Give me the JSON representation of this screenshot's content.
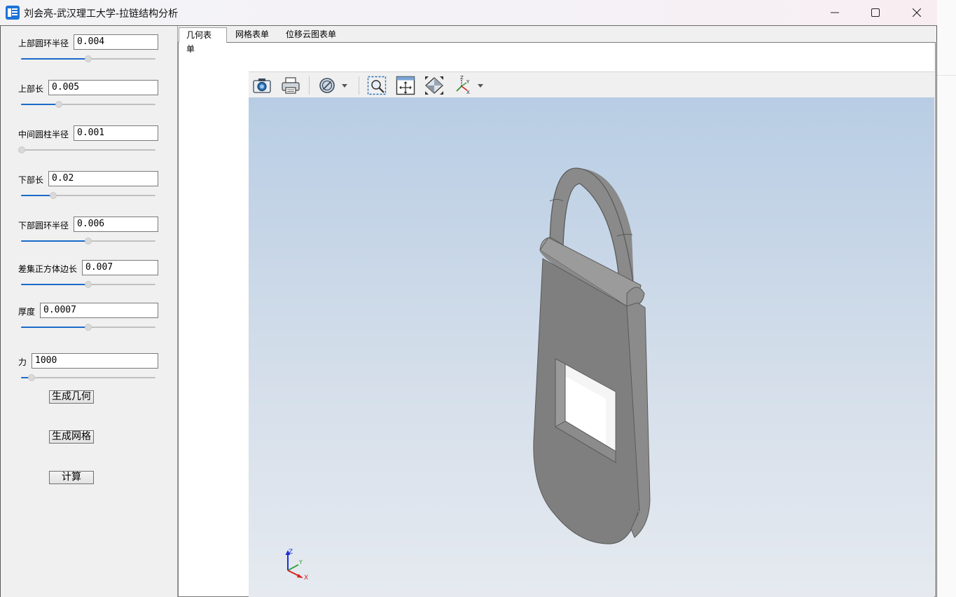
{
  "window": {
    "title": "刘会亮-武汉理工大学-拉链结构分析",
    "controls": [
      "minimize-icon",
      "maximize-icon",
      "close-icon"
    ]
  },
  "params": [
    {
      "label": "上部圆环半径",
      "value": "0.004",
      "slider_fraction": 0.5
    },
    {
      "label": "上部长",
      "value": "0.005",
      "slider_fraction": 0.28
    },
    {
      "label": "中间圆柱半径",
      "value": "0.001",
      "slider_fraction": 0.0
    },
    {
      "label": "下部长",
      "value": "0.02",
      "slider_fraction": 0.24
    },
    {
      "label": "下部圆环半径",
      "value": "0.006",
      "slider_fraction": 0.5
    },
    {
      "label": "差集正方体边长",
      "value": "0.007",
      "slider_fraction": 0.5
    },
    {
      "label": "厚度",
      "value": "0.0007",
      "slider_fraction": 0.5
    },
    {
      "label": "力",
      "value": "1000",
      "slider_fraction": 0.08
    }
  ],
  "buttons": {
    "generate_geometry": "生成几何",
    "generate_mesh": "生成网格",
    "compute": "计算"
  },
  "tabs": [
    {
      "label": "几何表单",
      "active": true
    },
    {
      "label": "网格表单",
      "active": false
    },
    {
      "label": "位移云图表单",
      "active": false
    }
  ],
  "viewer_toolbar": [
    "camera-icon",
    "print-icon",
    "display-mode-icon",
    "zoom-window-icon",
    "fit-all-icon",
    "view-fit-icon",
    "axis-view-icon"
  ],
  "triad": {
    "z": "Z",
    "y": "Y",
    "x": "X"
  },
  "colors": {
    "accent": "#1b6ac9",
    "model": "#7f7f7f",
    "viewport_top": "#b8cde4",
    "viewport_bottom": "#e6eaf0"
  }
}
